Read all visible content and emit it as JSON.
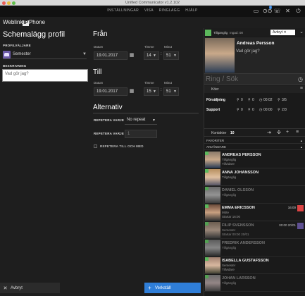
{
  "window": {
    "title": "Unified Communicator v1.2.102"
  },
  "menu": {
    "items": [
      "INSTÄLLNINGAR",
      "VISA",
      "RINGLAGG",
      "HJÄLP"
    ],
    "badge": "1"
  },
  "logo": {
    "text_before": "Weblink",
    "ip": "IP",
    "text_after": "Phone"
  },
  "page": {
    "title": "Schemalägg profil"
  },
  "profile": {
    "label": "PROFILVÄLJARE",
    "value": "Semester"
  },
  "description": {
    "label": "BESKRIVNING",
    "placeholder": "Vad gör jag?"
  },
  "from": {
    "title": "Från",
    "date_label": "Datum",
    "date": "19.01.2017",
    "hour_label": "Timme",
    "hour": "14",
    "minute_label": "Minut",
    "minute": "51"
  },
  "to": {
    "title": "Till",
    "date_label": "Datum",
    "date": "19.01.2017",
    "hour_label": "Timme",
    "hour": "15",
    "minute_label": "Minut",
    "minute": "51"
  },
  "alternatives": {
    "title": "Alternativ",
    "repeat_label": "REPETERA VARJE",
    "repeat_value": "No repeat",
    "repeat2_label": "REPETERA VARJE",
    "repeat2_value": "1",
    "until_label": "REPETERA TILL OCH MED"
  },
  "buttons": {
    "cancel": "Avbryt",
    "save": "Verkställ"
  },
  "status": {
    "text": "Tillgänglig",
    "sub": "Ingad: 00",
    "cancel": "Avbryt"
  },
  "me": {
    "name": "Andreas Persson",
    "note": "Vad gör jag?"
  },
  "search": {
    "placeholder": "Ring / Sök"
  },
  "queues": {
    "title": "Köer",
    "rows": [
      {
        "name": "Försäljning",
        "c1": "0",
        "c2": "0",
        "time": "00:02",
        "ratio": "3/5"
      },
      {
        "name": "Support",
        "c1": "0",
        "c2": "0",
        "time": "00:00",
        "ratio": "2/3"
      }
    ]
  },
  "contacts": {
    "title": "Kontakter",
    "count": "10",
    "groups": {
      "favorites": "FAVORITER",
      "users": "ANVÄNDARE"
    },
    "list": [
      {
        "name": "ANDREAS PERSSON",
        "s1": "Tillgänglig",
        "s2": "Tillvidare",
        "meta": "",
        "color": "#5cb85c"
      },
      {
        "name": "ANNA JOHANSSON",
        "s1": "Tillgänglig",
        "s2": "",
        "meta": "",
        "color": "#5cb85c"
      },
      {
        "name": "DANIEL OLSSON",
        "s1": "Tillgänglig",
        "s2": "",
        "meta": "",
        "color": "#5cb85c"
      },
      {
        "name": "EMMA ERICSSON",
        "s1": "Möte",
        "s2": "Startar 16:00",
        "meta": "16:00",
        "color": "#5cb85c"
      },
      {
        "name": "FILIP SVENSSON",
        "s1": "Semester",
        "s2": "Startar 00:00 20/01",
        "meta": "00:00 20/01",
        "color": "#5cb85c"
      },
      {
        "name": "FREDRIK ANDERSSON",
        "s1": "Tillgänglig",
        "s2": "",
        "meta": "",
        "color": "#5cb85c"
      },
      {
        "name": "ISABELLA GUSTAFSSON",
        "s1": "Semester",
        "s2": "Tillvidare",
        "meta": "",
        "color": "#5cb85c"
      },
      {
        "name": "JOHAN LARSSON",
        "s1": "Tillgänglig",
        "s2": "",
        "meta": "",
        "color": "#5cb85c"
      }
    ]
  },
  "colors": {
    "accent": "#2f7ed8",
    "available": "#5cb85c",
    "background": "#1e1e1e"
  }
}
